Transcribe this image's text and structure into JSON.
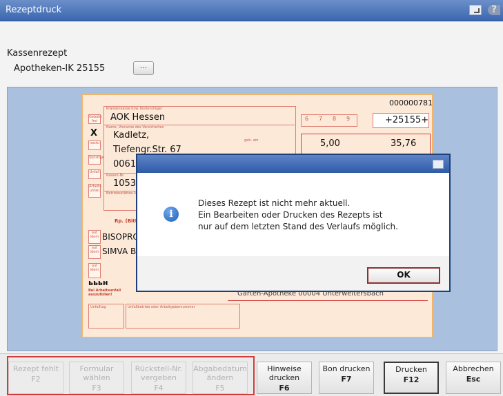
{
  "window": {
    "title": "Rezeptdruck"
  },
  "header": {
    "type_label": "Kassenrezept",
    "ik_label": "Apotheken-IK 25155",
    "dots_label": "..."
  },
  "form": {
    "number": "000000781",
    "insurer_caption": "Krankenkasse bzw. Kostenträger",
    "insurer": "AOK Hessen",
    "ik_value": "+25155+",
    "mark": "X",
    "name_caption": "Name, Vorname des Versicherten",
    "patient_name": "Kadletz,",
    "street": "Tiefengr.Str. 67",
    "city": "00616 Blir",
    "birth_caption": "geb. am",
    "kassen_caption": "Kassen-Nr.",
    "kassen_nr": "10531314",
    "betrieb_caption": "Betriebsstätten-Nr.",
    "zuzahlung": "5,00",
    "brutto": "35,76",
    "digits": [
      "6",
      "7",
      "8",
      "9"
    ],
    "rp_label": "Rp. (Bitte Leerr",
    "drug1": "BISOPROL",
    "drug2": "SIMVA BAS",
    "side_labels": [
      "Gebühr frei",
      "noctu",
      "Sonstige",
      "Unfall",
      "Arbeits unfall",
      "aut idem",
      "aut idem",
      "aut idem"
    ],
    "arbeits_label": "Bei Arbeitsunfall auszufüllen!",
    "unfalltag": "Unfalltag",
    "unfallbetrieb": "Unfallbetrieb oder Arbeitgebernummer",
    "pharmacy_line": "Gärten-Apotheke 00004 Unterweitersbach",
    "stamp": "ьььн"
  },
  "dialog": {
    "line1": "Dieses Rezept ist nicht mehr aktuell.",
    "line2": "Ein Bearbeiten oder Drucken des Rezepts ist",
    "line3": "nur auf dem letzten Stand des Verlaufs möglich.",
    "ok_label": "OK",
    "icon": "i"
  },
  "fkeys": [
    {
      "label": "Rezept fehlt",
      "key": "F2"
    },
    {
      "label": "Formular wählen",
      "key": "F3"
    },
    {
      "label": "Rückstell-Nr. vergeben",
      "key": "F4"
    },
    {
      "label": "Abgabedatum ändern",
      "key": "F5"
    },
    {
      "label": "Hinweise drucken",
      "key": "F6"
    },
    {
      "label": "Bon drucken",
      "key": "F7"
    },
    {
      "label": "Drucken",
      "key": "F12"
    },
    {
      "label": "Abbrechen",
      "key": "Esc"
    }
  ]
}
